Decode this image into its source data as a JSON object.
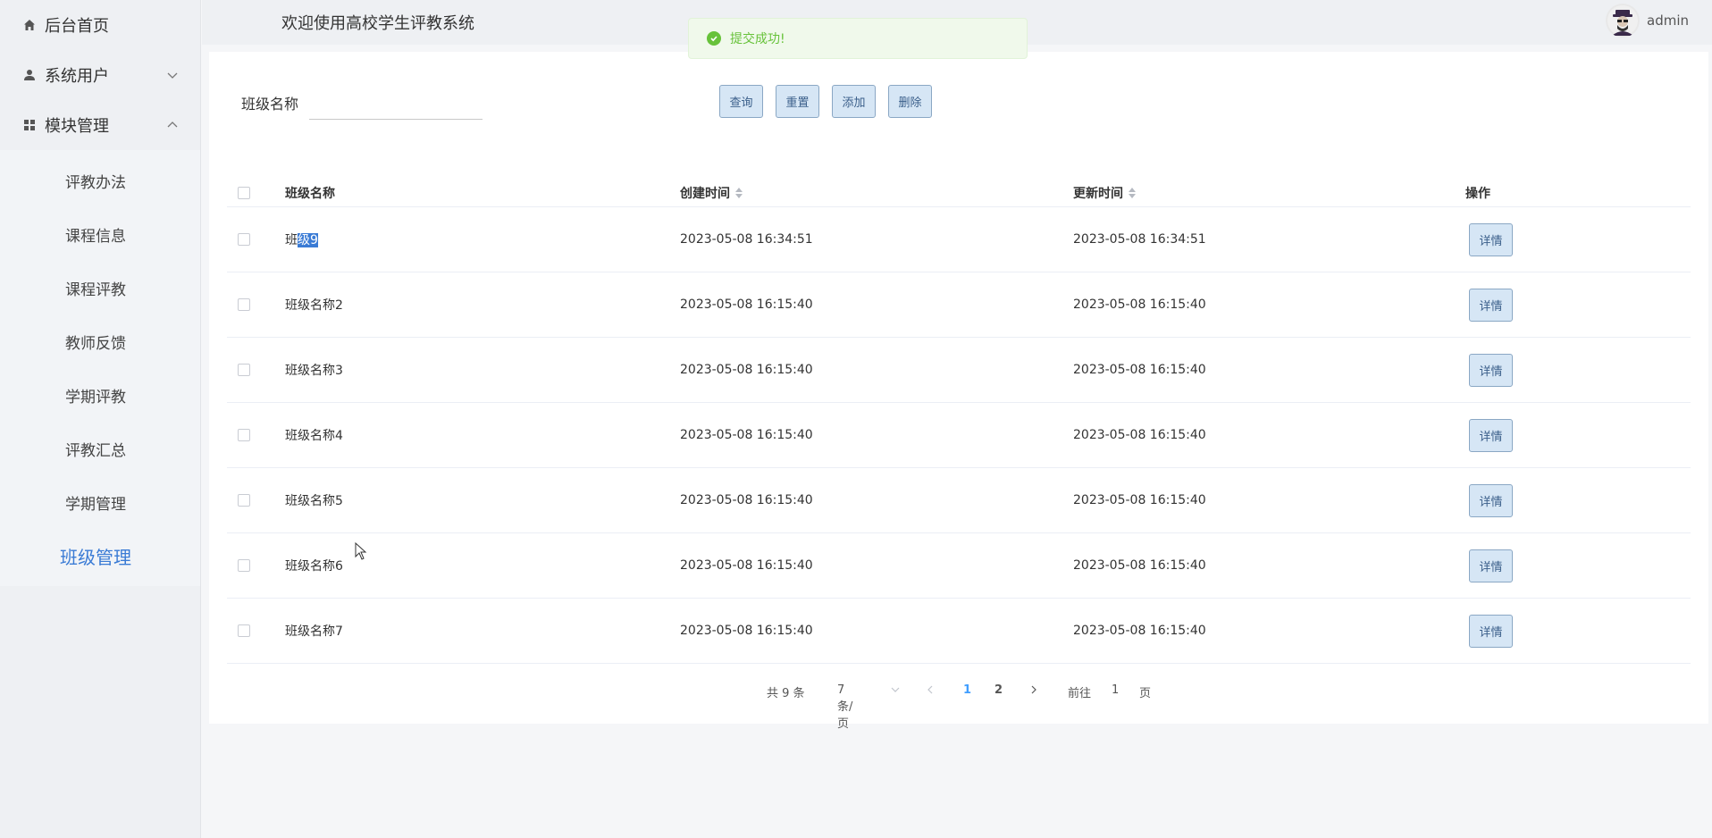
{
  "sidebar": {
    "home": "后台首页",
    "system_users": "系统用户",
    "module_management": "模块管理",
    "sub_items": [
      "评教办法",
      "课程信息",
      "课程评教",
      "教师反馈",
      "学期评教",
      "评教汇总",
      "学期管理",
      "班级管理"
    ],
    "active_item": "班级管理"
  },
  "header": {
    "welcome": "欢迎使用高校学生评教系统",
    "username": "admin"
  },
  "toast": {
    "message": "提交成功!"
  },
  "search": {
    "label": "班级名称",
    "value": "",
    "placeholder": ""
  },
  "toolbar": {
    "query": "查询",
    "reset": "重置",
    "add": "添加",
    "delete": "删除"
  },
  "table": {
    "columns": [
      "班级名称",
      "创建时间",
      "更新时间",
      "操作"
    ],
    "action_label": "详情",
    "rows": [
      {
        "name_prefix": "班",
        "name_selected": "级9",
        "created": "2023-05-08 16:34:51",
        "updated": "2023-05-08 16:34:51"
      },
      {
        "name": "班级名称2",
        "created": "2023-05-08 16:15:40",
        "updated": "2023-05-08 16:15:40"
      },
      {
        "name": "班级名称3",
        "created": "2023-05-08 16:15:40",
        "updated": "2023-05-08 16:15:40"
      },
      {
        "name": "班级名称4",
        "created": "2023-05-08 16:15:40",
        "updated": "2023-05-08 16:15:40"
      },
      {
        "name": "班级名称5",
        "created": "2023-05-08 16:15:40",
        "updated": "2023-05-08 16:15:40"
      },
      {
        "name": "班级名称6",
        "created": "2023-05-08 16:15:40",
        "updated": "2023-05-08 16:15:40"
      },
      {
        "name": "班级名称7",
        "created": "2023-05-08 16:15:40",
        "updated": "2023-05-08 16:15:40"
      }
    ]
  },
  "pagination": {
    "total": "共 9 条",
    "page_size": "7条/页",
    "pages": [
      "1",
      "2"
    ],
    "current": "1",
    "goto_prefix": "前往",
    "goto_value": "1",
    "goto_suffix": "页"
  },
  "colors": {
    "accent": "#3a7bd5",
    "success": "#67c23a",
    "button_bg": "#d6e6f5"
  }
}
